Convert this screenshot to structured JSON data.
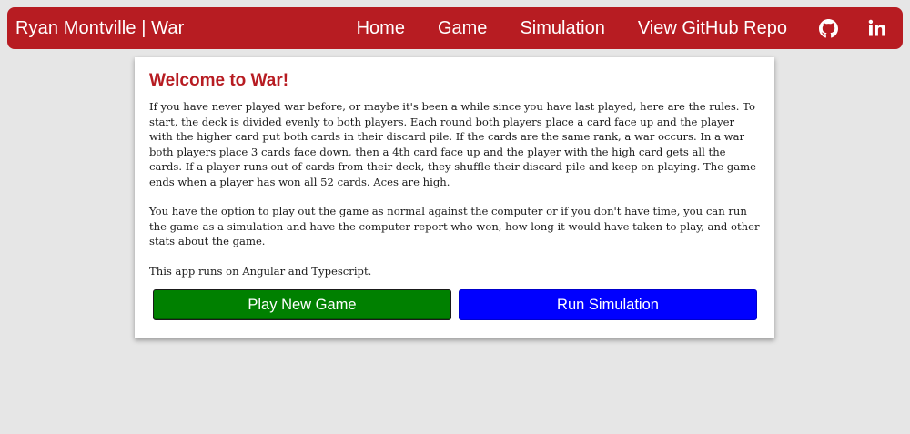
{
  "navbar": {
    "brand": "Ryan Montville | War",
    "links": [
      "Home",
      "Game",
      "Simulation",
      "View GitHub Repo"
    ],
    "icons": [
      "github-icon",
      "linkedin-icon"
    ],
    "color": "#b71c22"
  },
  "intro": {
    "title": "Welcome to War!",
    "paragraphs": [
      "If you have never played war before, or maybe it's been a while since you have last played, here are the rules. To start, the deck is divided evenly to both players. Each round both players place a card face up and the player with the higher card put both cards in their discard pile. If the cards are the same rank, a war occurs. In a war both players place 3 cards face down, then a 4th card face up and the player with the high card gets all the cards. If a player runs out of cards from their deck, they shuffle their discard pile and keep on playing. The game ends when a player has won all 52 cards. Aces are high.",
      "You have the option to play out the game as normal against the computer or if you don't have time, you can run the game as a simulation and have the computer report who won, how long it would have taken to play, and other stats about the game.",
      "This app runs on Angular and Typescript."
    ]
  },
  "actions": {
    "play_label": "Play New Game",
    "play_color": "#008000",
    "simulate_label": "Run Simulation",
    "simulate_color": "#0000ff"
  }
}
